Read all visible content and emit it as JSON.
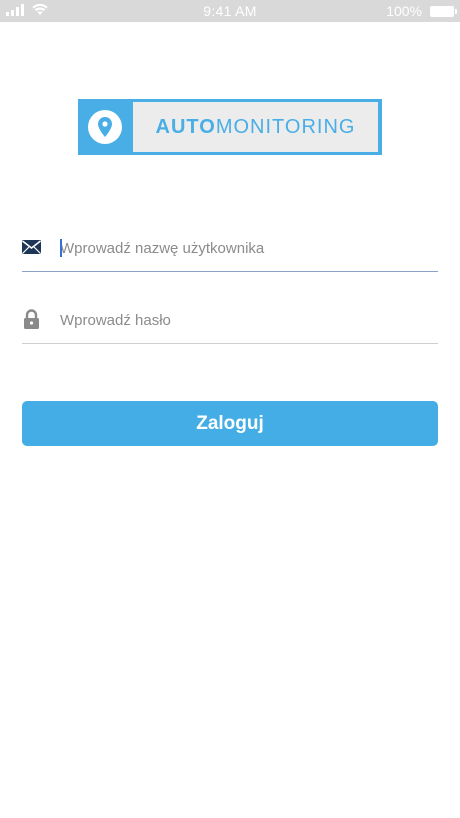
{
  "status_bar": {
    "time": "9:41 AM",
    "battery_text": "100%",
    "icons": [
      "signal-icon",
      "wifi-icon",
      "battery-icon"
    ]
  },
  "logo": {
    "text_bold": "AUTO",
    "text_regular": "MONITORING",
    "icon": "location-pin-icon",
    "colors": {
      "brand_blue": "#4aaee6",
      "panel": "#ececec"
    }
  },
  "form": {
    "username": {
      "placeholder": "Wprowadź nazwę użytkownika",
      "value": "",
      "icon": "envelope-icon"
    },
    "password": {
      "placeholder": "Wprowadź hasło",
      "value": "",
      "icon": "lock-icon"
    },
    "login_label": "Zaloguj"
  },
  "colors": {
    "button": "#45ade6",
    "icon_dark": "#1d3557",
    "icon_gray": "#8a8a8a"
  }
}
